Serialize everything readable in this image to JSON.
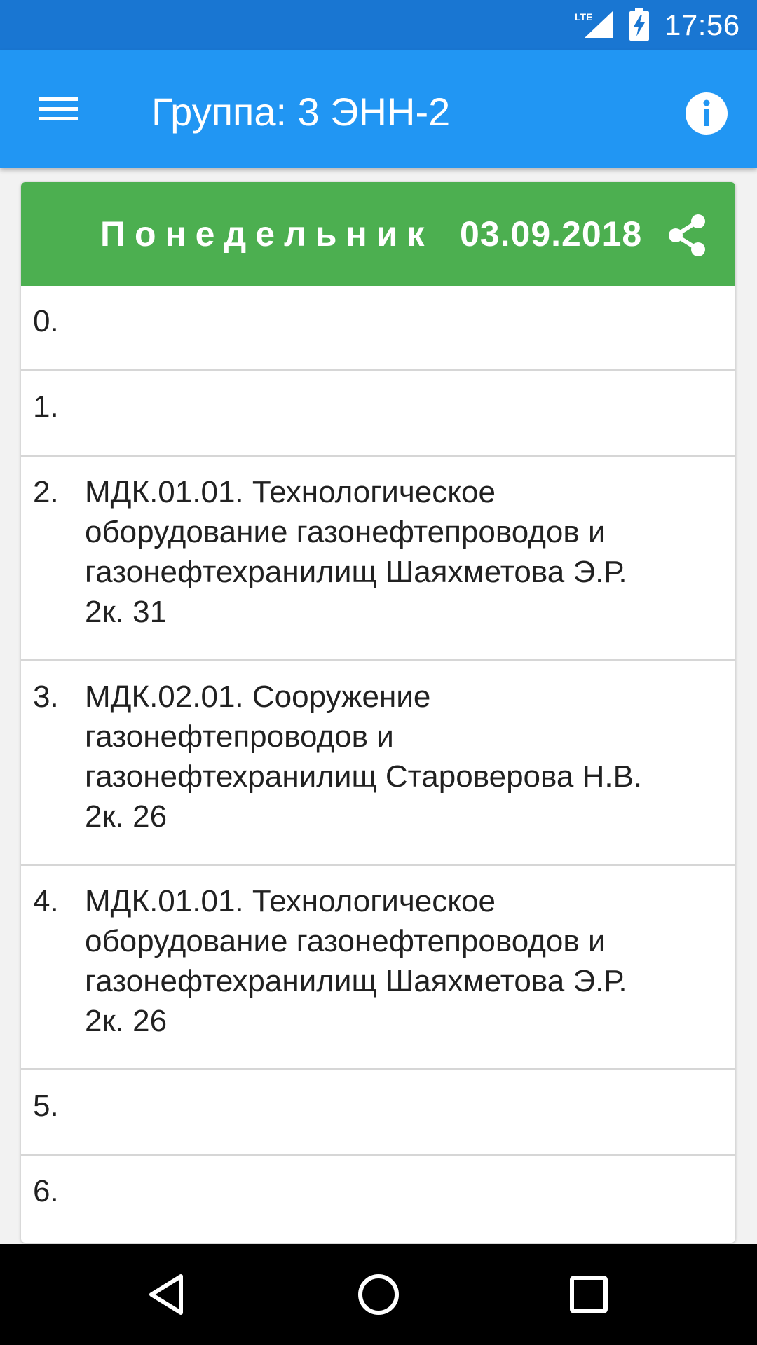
{
  "status_bar": {
    "network": "LTE",
    "time": "17:56",
    "icons": [
      "lte-signal-icon",
      "battery-charging-icon"
    ]
  },
  "app_bar": {
    "title": "Группа: 3 ЭНН-2",
    "menu_icon": "hamburger-menu-icon",
    "info_icon": "info-icon"
  },
  "schedule": {
    "day": "Понедельник",
    "date": "03.09.2018",
    "share_icon": "share-icon",
    "lessons": [
      {
        "number": "0.",
        "text": ""
      },
      {
        "number": "1.",
        "text": ""
      },
      {
        "number": "2.",
        "text": "МДК.01.01. Технологическое\nоборудование газонефтепроводов и\nгазонефтехранилищ Шаяхметова Э.Р.\n2к. 31"
      },
      {
        "number": "3.",
        "text": "МДК.02.01. Сооружение\nгазонефтепроводов и\nгазонефтехранилищ Староверова Н.В.\n2к. 26"
      },
      {
        "number": "4.",
        "text": "МДК.01.01. Технологическое\nоборудование газонефтепроводов и\nгазонефтехранилищ Шаяхметова Э.Р.\n2к. 26"
      },
      {
        "number": "5.",
        "text": ""
      },
      {
        "number": "6.",
        "text": ""
      }
    ]
  },
  "colors": {
    "status_bar": "#1976d2",
    "app_bar": "#2196f3",
    "day_header": "#4caf50",
    "divider": "#d6d6d6",
    "nav_bar": "#000000"
  },
  "nav_bar": {
    "icons": [
      "back-icon",
      "home-icon",
      "recents-icon"
    ]
  }
}
